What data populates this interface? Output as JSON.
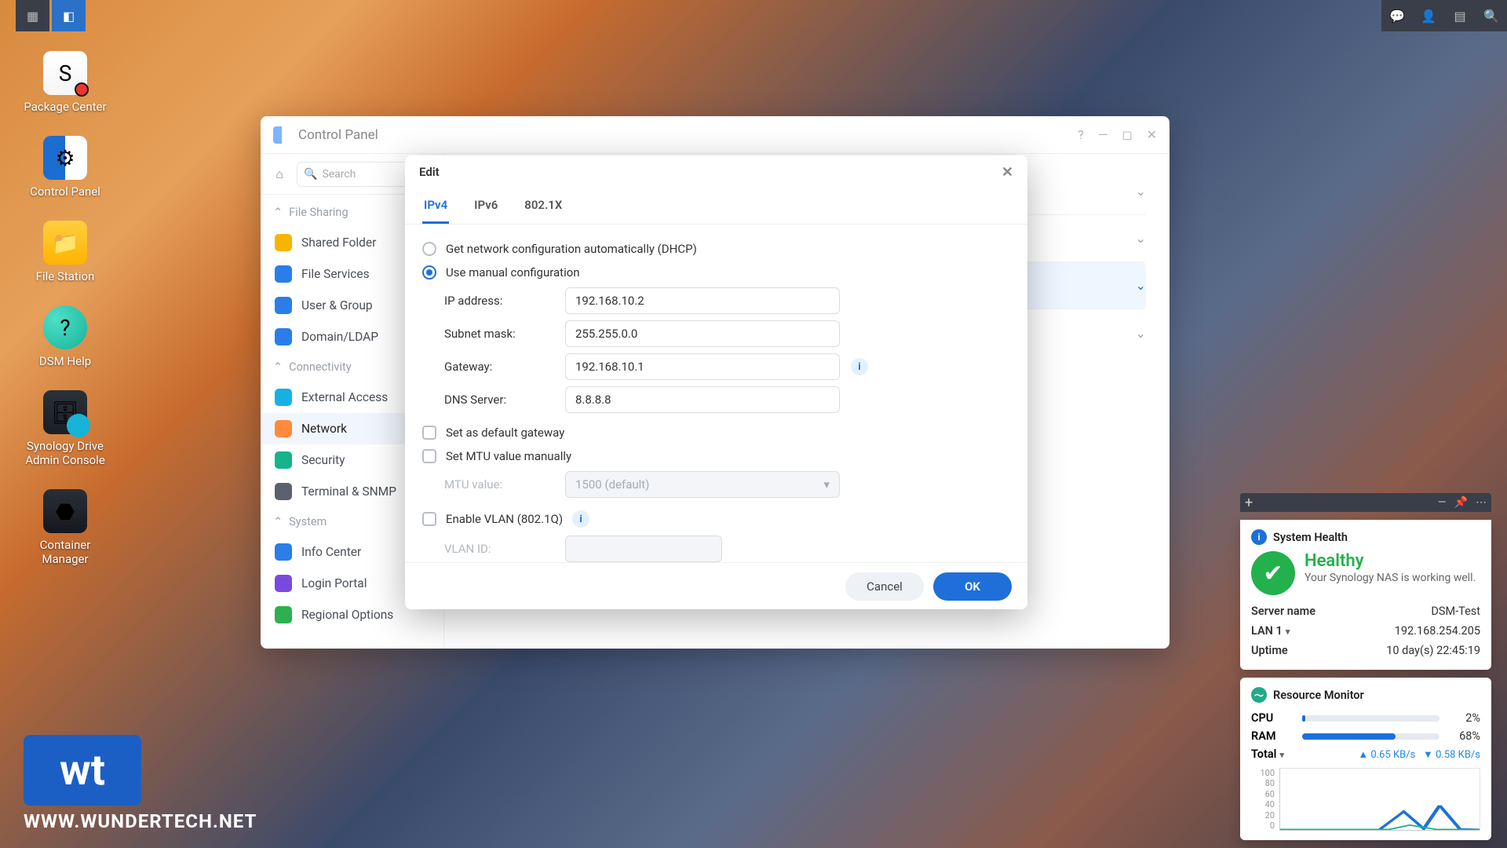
{
  "taskbar": {
    "notif_badge": true
  },
  "desktop": [
    {
      "id": "package-center",
      "label": "Package Center",
      "cls": "pkg",
      "glyph": "S"
    },
    {
      "id": "control-panel",
      "label": "Control Panel",
      "cls": "cp",
      "glyph": "⚙"
    },
    {
      "id": "file-station",
      "label": "File Station",
      "cls": "fs",
      "glyph": "📁"
    },
    {
      "id": "dsm-help",
      "label": "DSM Help",
      "cls": "help",
      "glyph": "?"
    },
    {
      "id": "synology-drive",
      "label": "Synology Drive Admin Console",
      "cls": "drive",
      "glyph": "🗄"
    },
    {
      "id": "container-manager",
      "label": "Container Manager",
      "cls": "cm",
      "glyph": "⬣"
    }
  ],
  "watermark": {
    "logo": "wt",
    "url": "WWW.WUNDERTECH.NET"
  },
  "control_panel": {
    "title": "Control Panel",
    "search_placeholder": "Search",
    "groups": [
      {
        "label": "File Sharing",
        "items": [
          {
            "id": "shared-folder",
            "label": "Shared Folder",
            "cls": "folder"
          },
          {
            "id": "file-services",
            "label": "File Services",
            "cls": "files"
          },
          {
            "id": "user-group",
            "label": "User & Group",
            "cls": "users"
          },
          {
            "id": "domain-ldap",
            "label": "Domain/LDAP",
            "cls": "domain"
          }
        ]
      },
      {
        "label": "Connectivity",
        "items": [
          {
            "id": "external-access",
            "label": "External Access",
            "cls": "ext"
          },
          {
            "id": "network",
            "label": "Network",
            "cls": "net",
            "active": true
          },
          {
            "id": "security",
            "label": "Security",
            "cls": "sec"
          },
          {
            "id": "terminal-snmp",
            "label": "Terminal & SNMP",
            "cls": "term"
          }
        ]
      },
      {
        "label": "System",
        "items": [
          {
            "id": "info-center",
            "label": "Info Center",
            "cls": "info"
          },
          {
            "id": "login-portal",
            "label": "Login Portal",
            "cls": "login"
          },
          {
            "id": "regional-options",
            "label": "Regional Options",
            "cls": "region"
          }
        ]
      }
    ]
  },
  "modal": {
    "title": "Edit",
    "tabs": [
      "IPv4",
      "IPv6",
      "802.1X"
    ],
    "active_tab": 0,
    "radio": {
      "dhcp": "Get network configuration automatically (DHCP)",
      "manual": "Use manual configuration",
      "selected": "manual"
    },
    "fields": {
      "ip_label": "IP address:",
      "ip": "192.168.10.2",
      "mask_label": "Subnet mask:",
      "mask": "255.255.0.0",
      "gw_label": "Gateway:",
      "gw": "192.168.10.1",
      "dns_label": "DNS Server:",
      "dns": "8.8.8.8"
    },
    "checks": {
      "default_gw": "Set as default gateway",
      "mtu_manual": "Set MTU value manually",
      "mtu_label": "MTU value:",
      "mtu_value": "1500 (default)",
      "vlan": "Enable VLAN (802.1Q)",
      "vlan_label": "VLAN ID:"
    },
    "buttons": {
      "cancel": "Cancel",
      "ok": "OK"
    }
  },
  "health": {
    "title": "System Health",
    "status": "Healthy",
    "sub": "Your Synology NAS is working well.",
    "rows": [
      {
        "k": "Server name",
        "v": "DSM-Test"
      },
      {
        "k": "LAN 1",
        "v": "192.168.254.205",
        "drop": true
      },
      {
        "k": "Uptime",
        "v": "10 day(s) 22:45:19"
      }
    ]
  },
  "resmon": {
    "title": "Resource Monitor",
    "cpu": {
      "label": "CPU",
      "pct": 2
    },
    "ram": {
      "label": "RAM",
      "pct": 68
    },
    "total": {
      "label": "Total",
      "up": "0.65 KB/s",
      "dn": "0.58 KB/s"
    },
    "y_ticks": [
      "100",
      "80",
      "60",
      "40",
      "20",
      "0"
    ]
  }
}
